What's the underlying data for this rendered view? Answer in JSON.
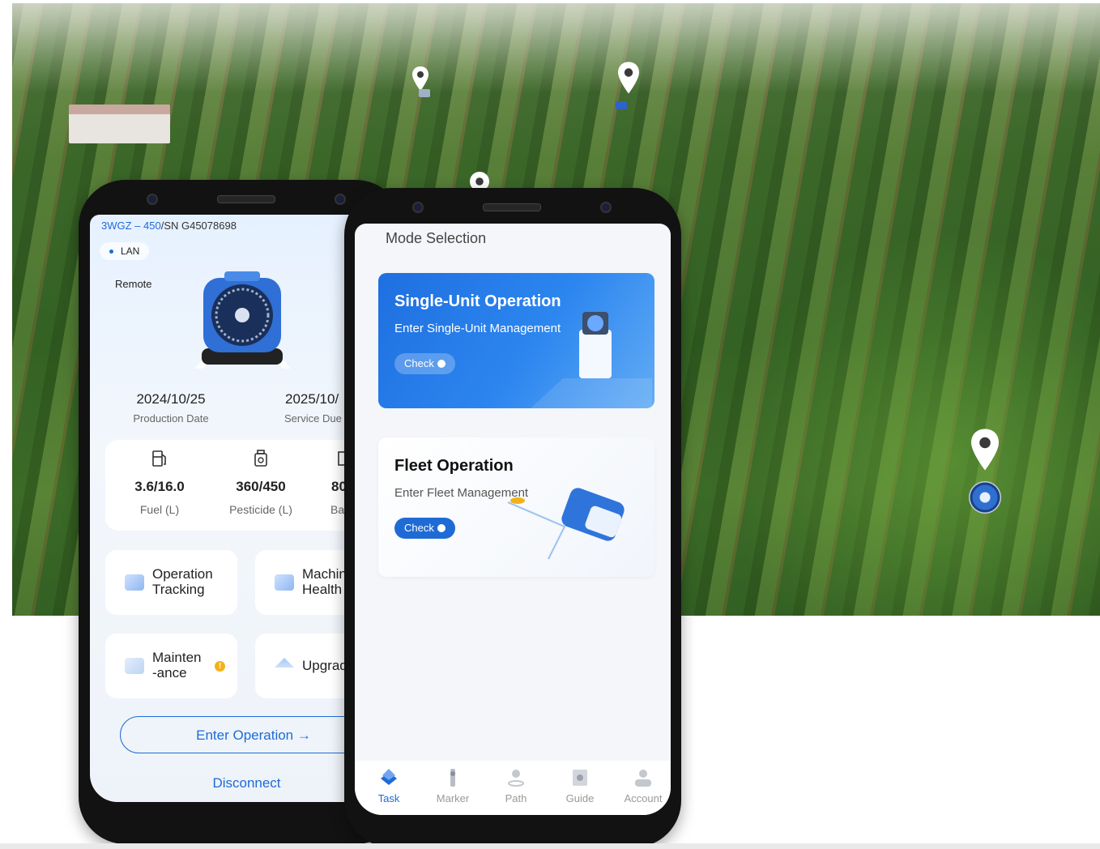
{
  "left_phone": {
    "model": "3WGZ – 450",
    "serial": "/SN G45078698",
    "connection": "LAN",
    "control_mode": "Remote",
    "production_date": "2024/10/25",
    "production_date_label": "Production Date",
    "service_due": "2025/10/",
    "service_due_label": "Service Due",
    "stats": [
      {
        "value": "3.6/16.0",
        "label": "Fuel (L)",
        "icon": "fuel-icon"
      },
      {
        "value": "360/450",
        "label": "Pesticide (L)",
        "icon": "pesticide-icon"
      },
      {
        "value": "80",
        "label": "Bat",
        "icon": "battery-icon"
      }
    ],
    "tiles": [
      {
        "label": "Operation\nTracking",
        "icon": "tracking-icon"
      },
      {
        "label": "Machin\nHealth",
        "icon": "health-icon"
      },
      {
        "label": "Mainten\n-ance",
        "icon": "maintenance-icon",
        "alert": "!"
      },
      {
        "label": "Upgrad",
        "icon": "upgrade-icon"
      }
    ],
    "enter_operation": "Enter Operation",
    "enter_arrow": "→",
    "disconnect": "Disconnect"
  },
  "right_phone": {
    "title": "Mode Selection",
    "single": {
      "title": "Single-Unit Operation",
      "subtitle": "Enter Single-Unit Management",
      "check": "Check"
    },
    "fleet": {
      "title": "Fleet Operation",
      "subtitle": "Enter Fleet Management",
      "check": "Check"
    },
    "tabs": [
      {
        "label": "Task",
        "icon": "task-icon",
        "active": true
      },
      {
        "label": "Marker",
        "icon": "marker-icon"
      },
      {
        "label": "Path",
        "icon": "path-icon"
      },
      {
        "label": "Guide",
        "icon": "guide-icon"
      },
      {
        "label": "Account",
        "icon": "account-icon"
      }
    ]
  },
  "colors": {
    "accent": "#1f6bd6",
    "warning": "#f3b21b",
    "card_gradient_start": "#1f6fe0",
    "card_gradient_end": "#63acf5"
  }
}
